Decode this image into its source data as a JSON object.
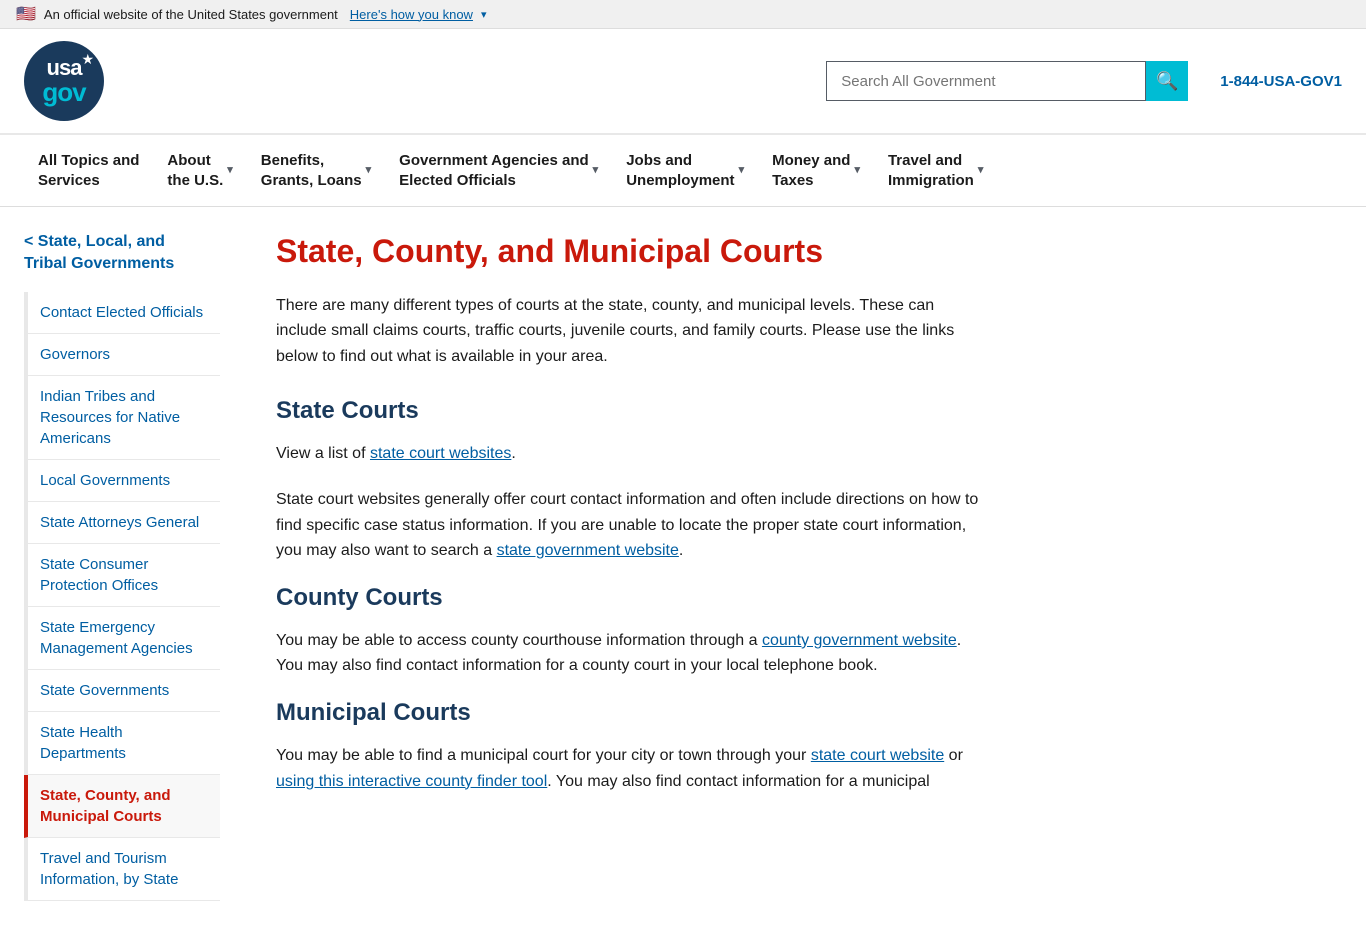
{
  "govBanner": {
    "flagEmoji": "🇺🇸",
    "officialText": "An official website of the United States government",
    "heresHowText": "Here's how you know",
    "chevron": "▾"
  },
  "header": {
    "logoUsaText": "usa",
    "logoGovText": "gov",
    "searchPlaceholder": "Search All Government",
    "searchButtonLabel": "Search",
    "phoneNumber": "1-844-USA-GOV1"
  },
  "nav": {
    "items": [
      {
        "id": "all-topics",
        "label": "All Topics and\nServices",
        "hasDropdown": false
      },
      {
        "id": "about-us",
        "label": "About\nthe U.S.",
        "hasDropdown": true
      },
      {
        "id": "benefits",
        "label": "Benefits,\nGrants, Loans",
        "hasDropdown": true
      },
      {
        "id": "gov-agencies",
        "label": "Government Agencies and\nElected Officials",
        "hasDropdown": true
      },
      {
        "id": "jobs",
        "label": "Jobs and\nUnemployment",
        "hasDropdown": true
      },
      {
        "id": "money-taxes",
        "label": "Money and\nTaxes",
        "hasDropdown": true
      },
      {
        "id": "travel",
        "label": "Travel and\nImmigration",
        "hasDropdown": true
      }
    ]
  },
  "sidebar": {
    "backLinkText": "< State, Local, and\nTribal Governments",
    "items": [
      {
        "id": "contact-elected",
        "label": "Contact Elected Officials",
        "active": false
      },
      {
        "id": "governors",
        "label": "Governors",
        "active": false
      },
      {
        "id": "indian-tribes",
        "label": "Indian Tribes and Resources for Native Americans",
        "active": false
      },
      {
        "id": "local-governments",
        "label": "Local Governments",
        "active": false
      },
      {
        "id": "state-attorneys",
        "label": "State Attorneys General",
        "active": false
      },
      {
        "id": "state-consumer",
        "label": "State Consumer Protection Offices",
        "active": false
      },
      {
        "id": "state-emergency",
        "label": "State Emergency Management Agencies",
        "active": false
      },
      {
        "id": "state-governments",
        "label": "State Governments",
        "active": false
      },
      {
        "id": "state-health",
        "label": "State Health Departments",
        "active": false
      },
      {
        "id": "state-courts",
        "label": "State, County, and Municipal Courts",
        "active": true
      },
      {
        "id": "travel-tourism",
        "label": "Travel and Tourism Information, by State",
        "active": false
      }
    ]
  },
  "mainContent": {
    "pageTitle": "State, County, and Municipal Courts",
    "introText": "There are many different types of courts at the state, county, and municipal levels. These can include small claims courts, traffic courts, juvenile courts, and family courts. Please use the links below to find out what is available in your area.",
    "sections": [
      {
        "id": "state-courts-section",
        "heading": "State Courts",
        "paragraphs": [
          {
            "id": "state-courts-p1",
            "text": "View a list of ",
            "linkText": "state court websites",
            "afterLink": "."
          },
          {
            "id": "state-courts-p2",
            "textBefore": "State court websites generally offer court contact information and often include directions on how to find specific case status information. If you are unable to locate the proper state court information, you may also want to search a ",
            "linkText": "state government website",
            "afterLink": "."
          }
        ]
      },
      {
        "id": "county-courts-section",
        "heading": "County Courts",
        "paragraphs": [
          {
            "id": "county-courts-p1",
            "textBefore": "You may be able to access county courthouse information through a ",
            "linkText": "county government website",
            "afterLink": ". You may also find contact information for a county court in your local telephone book."
          }
        ]
      },
      {
        "id": "municipal-courts-section",
        "heading": "Municipal Courts",
        "paragraphs": [
          {
            "id": "municipal-courts-p1",
            "textBefore": "You may be able to find a municipal court for your city or town through your ",
            "linkText": "state court website",
            "midText": " or ",
            "linkText2": "using this interactive county finder tool",
            "afterLink": ".  You may also find contact information for a municipal"
          }
        ]
      }
    ]
  }
}
